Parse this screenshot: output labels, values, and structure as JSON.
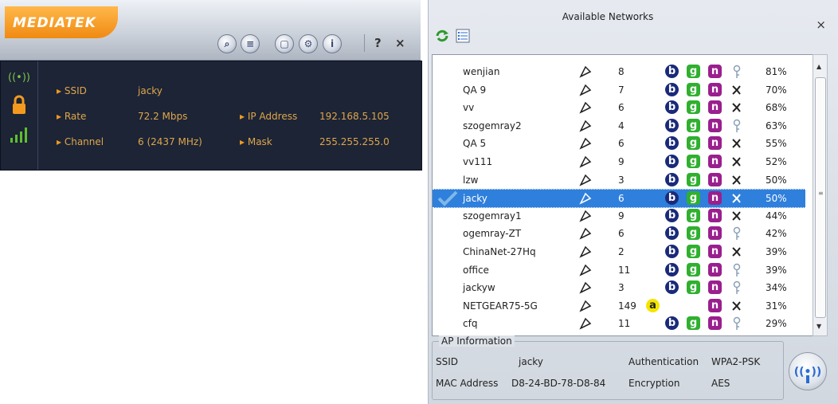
{
  "mediatek": {
    "logo_text": "MEDIATEK",
    "toolbar": {
      "help": "?",
      "close": "×"
    },
    "labels": {
      "ssid": "SSID",
      "rate": "Rate",
      "channel": "Channel",
      "ip": "IP Address",
      "mask": "Mask"
    },
    "values": {
      "ssid": "jacky",
      "rate": "72.2 Mbps",
      "channel": "6 (2437 MHz)",
      "ip": "192.168.5.105",
      "mask": "255.255.255.0"
    }
  },
  "networks_panel": {
    "title": "Available Networks",
    "close": "×",
    "rows": [
      {
        "ssid": "wenjian",
        "channel": "8",
        "signal": "81%",
        "secure": true
      },
      {
        "ssid": "QA 9",
        "channel": "7",
        "signal": "70%",
        "secure": false
      },
      {
        "ssid": "vv",
        "channel": "6",
        "signal": "68%",
        "secure": false
      },
      {
        "ssid": "szogemray2",
        "channel": "4",
        "signal": "63%",
        "secure": true
      },
      {
        "ssid": "QA 5",
        "channel": "6",
        "signal": "55%",
        "secure": false
      },
      {
        "ssid": "vv111",
        "channel": "9",
        "signal": "52%",
        "secure": false
      },
      {
        "ssid": "lzw",
        "channel": "3",
        "signal": "50%",
        "secure": false
      },
      {
        "ssid": "jacky",
        "channel": "6",
        "signal": "50%",
        "secure": false,
        "selected": true
      },
      {
        "ssid": "szogemray1",
        "channel": "9",
        "signal": "44%",
        "secure": false
      },
      {
        "ssid": "ogemray-ZT",
        "channel": "6",
        "signal": "42%",
        "secure": true
      },
      {
        "ssid": "ChinaNet-27Hq",
        "channel": "2",
        "signal": "39%",
        "secure": false
      },
      {
        "ssid": "office",
        "channel": "11",
        "signal": "39%",
        "secure": true
      },
      {
        "ssid": "jackyw",
        "channel": "3",
        "signal": "34%",
        "secure": true
      },
      {
        "ssid": "NETGEAR75-5G",
        "channel": "149",
        "signal": "31%",
        "secure": false,
        "band_a": true
      },
      {
        "ssid": "cfq",
        "channel": "11",
        "signal": "29%",
        "secure": true
      }
    ],
    "ap_info": {
      "title": "AP Information",
      "ssid_label": "SSID",
      "ssid_value": "jacky",
      "auth_label": "Authentication",
      "auth_value": "WPA2-PSK",
      "mac_label": "MAC Address",
      "mac_value": "D8-24-BD-78-D8-84",
      "enc_label": "Encryption",
      "enc_value": "AES"
    }
  },
  "colors": {
    "accent": "#f39a1e",
    "selection": "#2f7fdc",
    "dark_panel": "#1c2436"
  }
}
